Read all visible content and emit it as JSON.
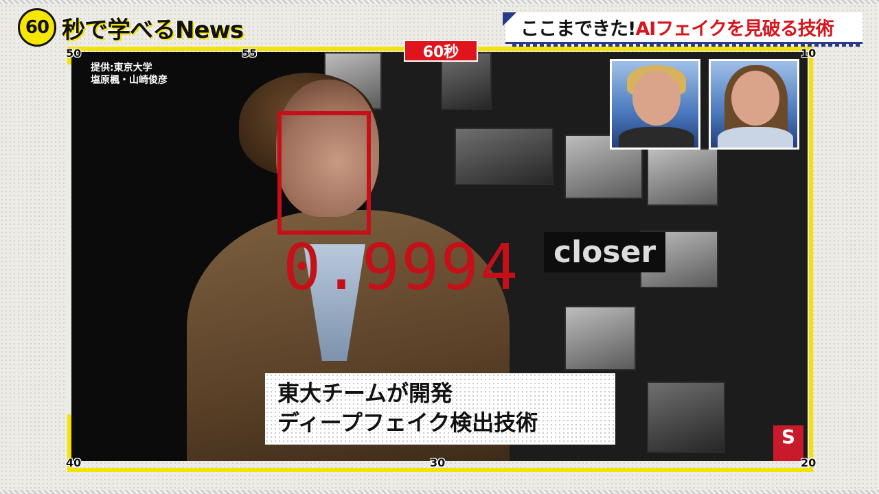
{
  "program": {
    "badge": "60",
    "title": "秒で学べるNews"
  },
  "topic": {
    "prefix": "ここまできた!",
    "highlight": "AIフェイクを見破る技術"
  },
  "timer": {
    "badge": "60秒",
    "ticks": {
      "top_left": "50",
      "top_mid": "55",
      "top_right": "10",
      "bottom_left": "40",
      "bottom_mid": "30",
      "bottom_right": "20"
    }
  },
  "video": {
    "credit": "提供:東京大学\n塩原楓・山崎俊彦",
    "background_word": "closer",
    "detection_score": "0.9994",
    "caption_line1": "東大チームが開発",
    "caption_line2": "ディープフェイク検出技術",
    "corner_logo": "S"
  },
  "colors": {
    "frame_yellow": "#f4e300",
    "timer_red": "#e0141c",
    "detection_red": "#c51018",
    "topic_navy": "#2a3a8a"
  }
}
